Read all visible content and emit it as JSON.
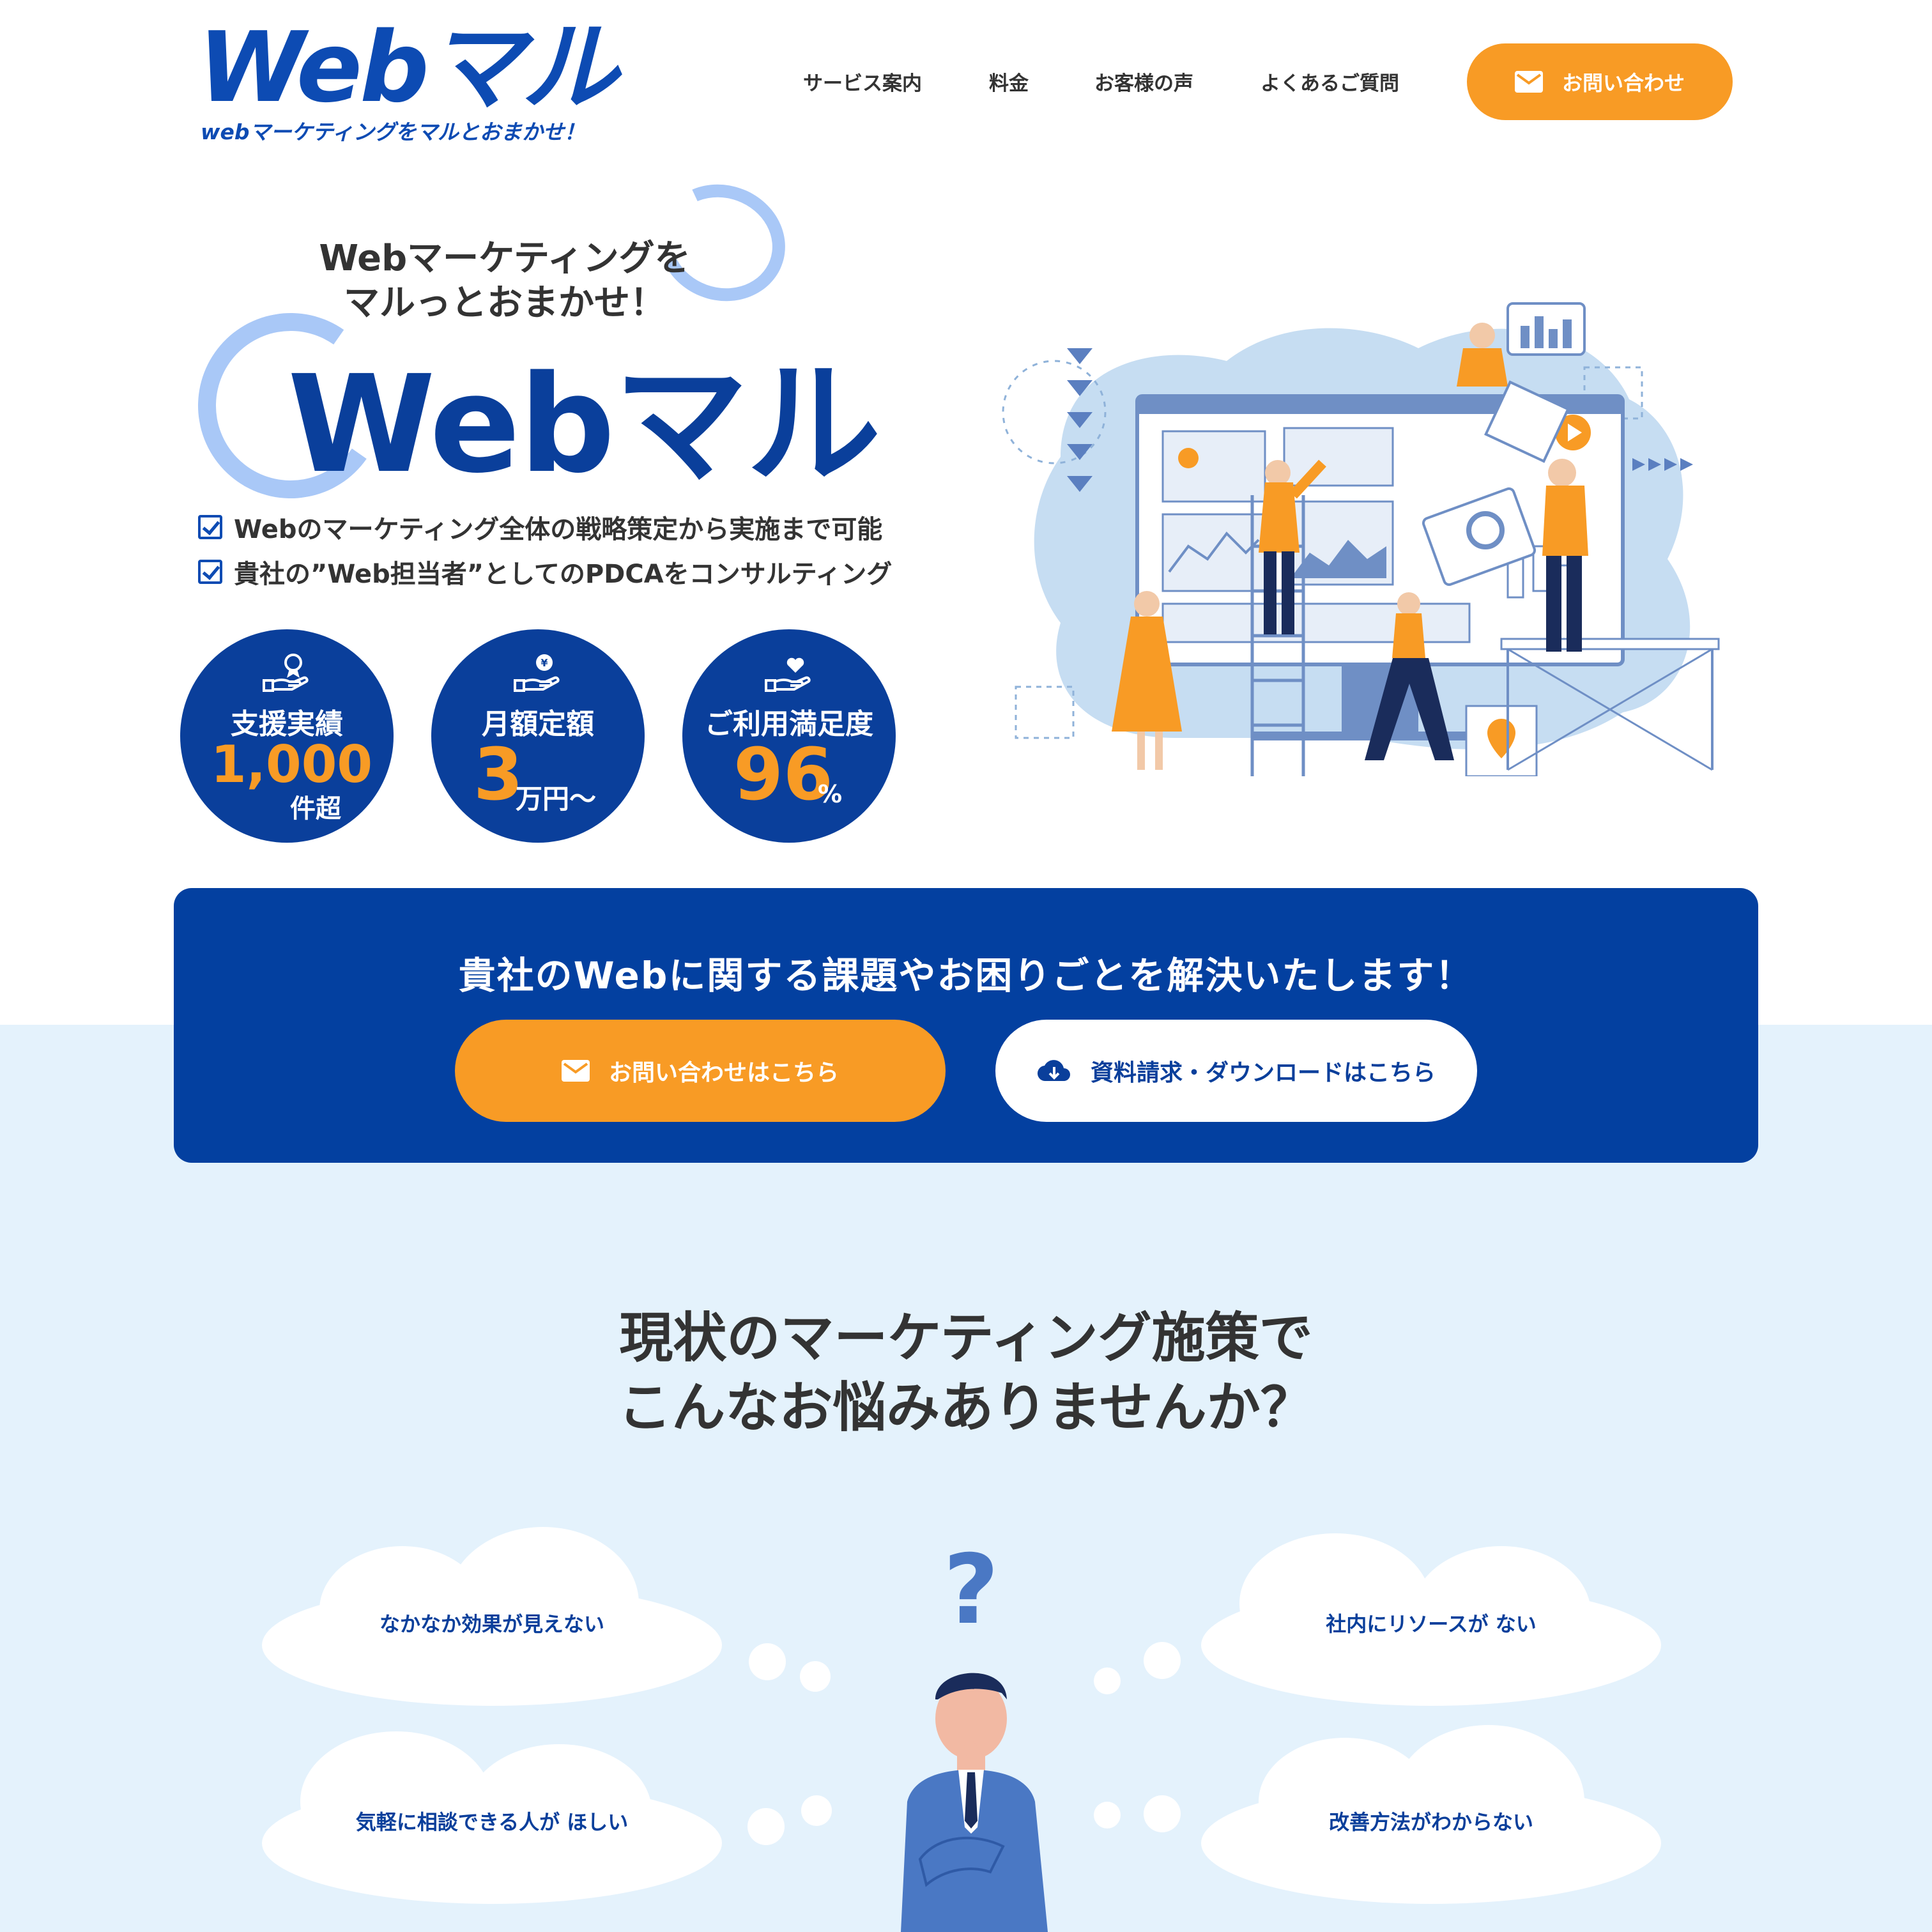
{
  "header": {
    "logo_main": "Webマル",
    "logo_tagline": "webマーケティングをマルとおまかせ！",
    "nav": [
      "サービス案内",
      "料金",
      "お客様の声",
      "よくあるご質問"
    ],
    "contact_button": "お問い合わせ"
  },
  "hero": {
    "tagline_line1": "Webマーケティングを",
    "tagline_line2": "マルっとおまかせ！",
    "title": "Webマル",
    "features": [
      "Webのマーケティング全体の戦略策定から実施まで可能",
      "貴社の”Web担当者”としてのPDCAをコンサルティング"
    ],
    "stats": [
      {
        "label": "支援実績",
        "value": "1,000",
        "unit": "件超",
        "icon": "award-hand-icon"
      },
      {
        "label": "月額定額",
        "value": "3",
        "unit": "万円〜",
        "icon": "yen-hand-icon"
      },
      {
        "label": "ご利用満足度",
        "value": "96",
        "unit": "%",
        "icon": "heart-hand-icon"
      }
    ]
  },
  "cta": {
    "heading": "貴社のWebに関する課題やお困りごとを解決いたします！",
    "contact_button": "お問い合わせはこちら",
    "download_button": "資料請求・ダウンロードはこちら"
  },
  "worries": {
    "title_line1": "現状のマーケティング施策で",
    "title_line2": "こんなお悩みありませんか？",
    "items": [
      "なかなか効果が見えない",
      "社内にリソースが ない",
      "気軽に相談できる人が ほしい",
      "改善方法がわからない"
    ]
  },
  "colors": {
    "brand_blue": "#0a3f9b",
    "accent_orange": "#f89b25",
    "light_blue_bg": "#e4f2fc",
    "ring_blue": "#a9c8f7"
  }
}
